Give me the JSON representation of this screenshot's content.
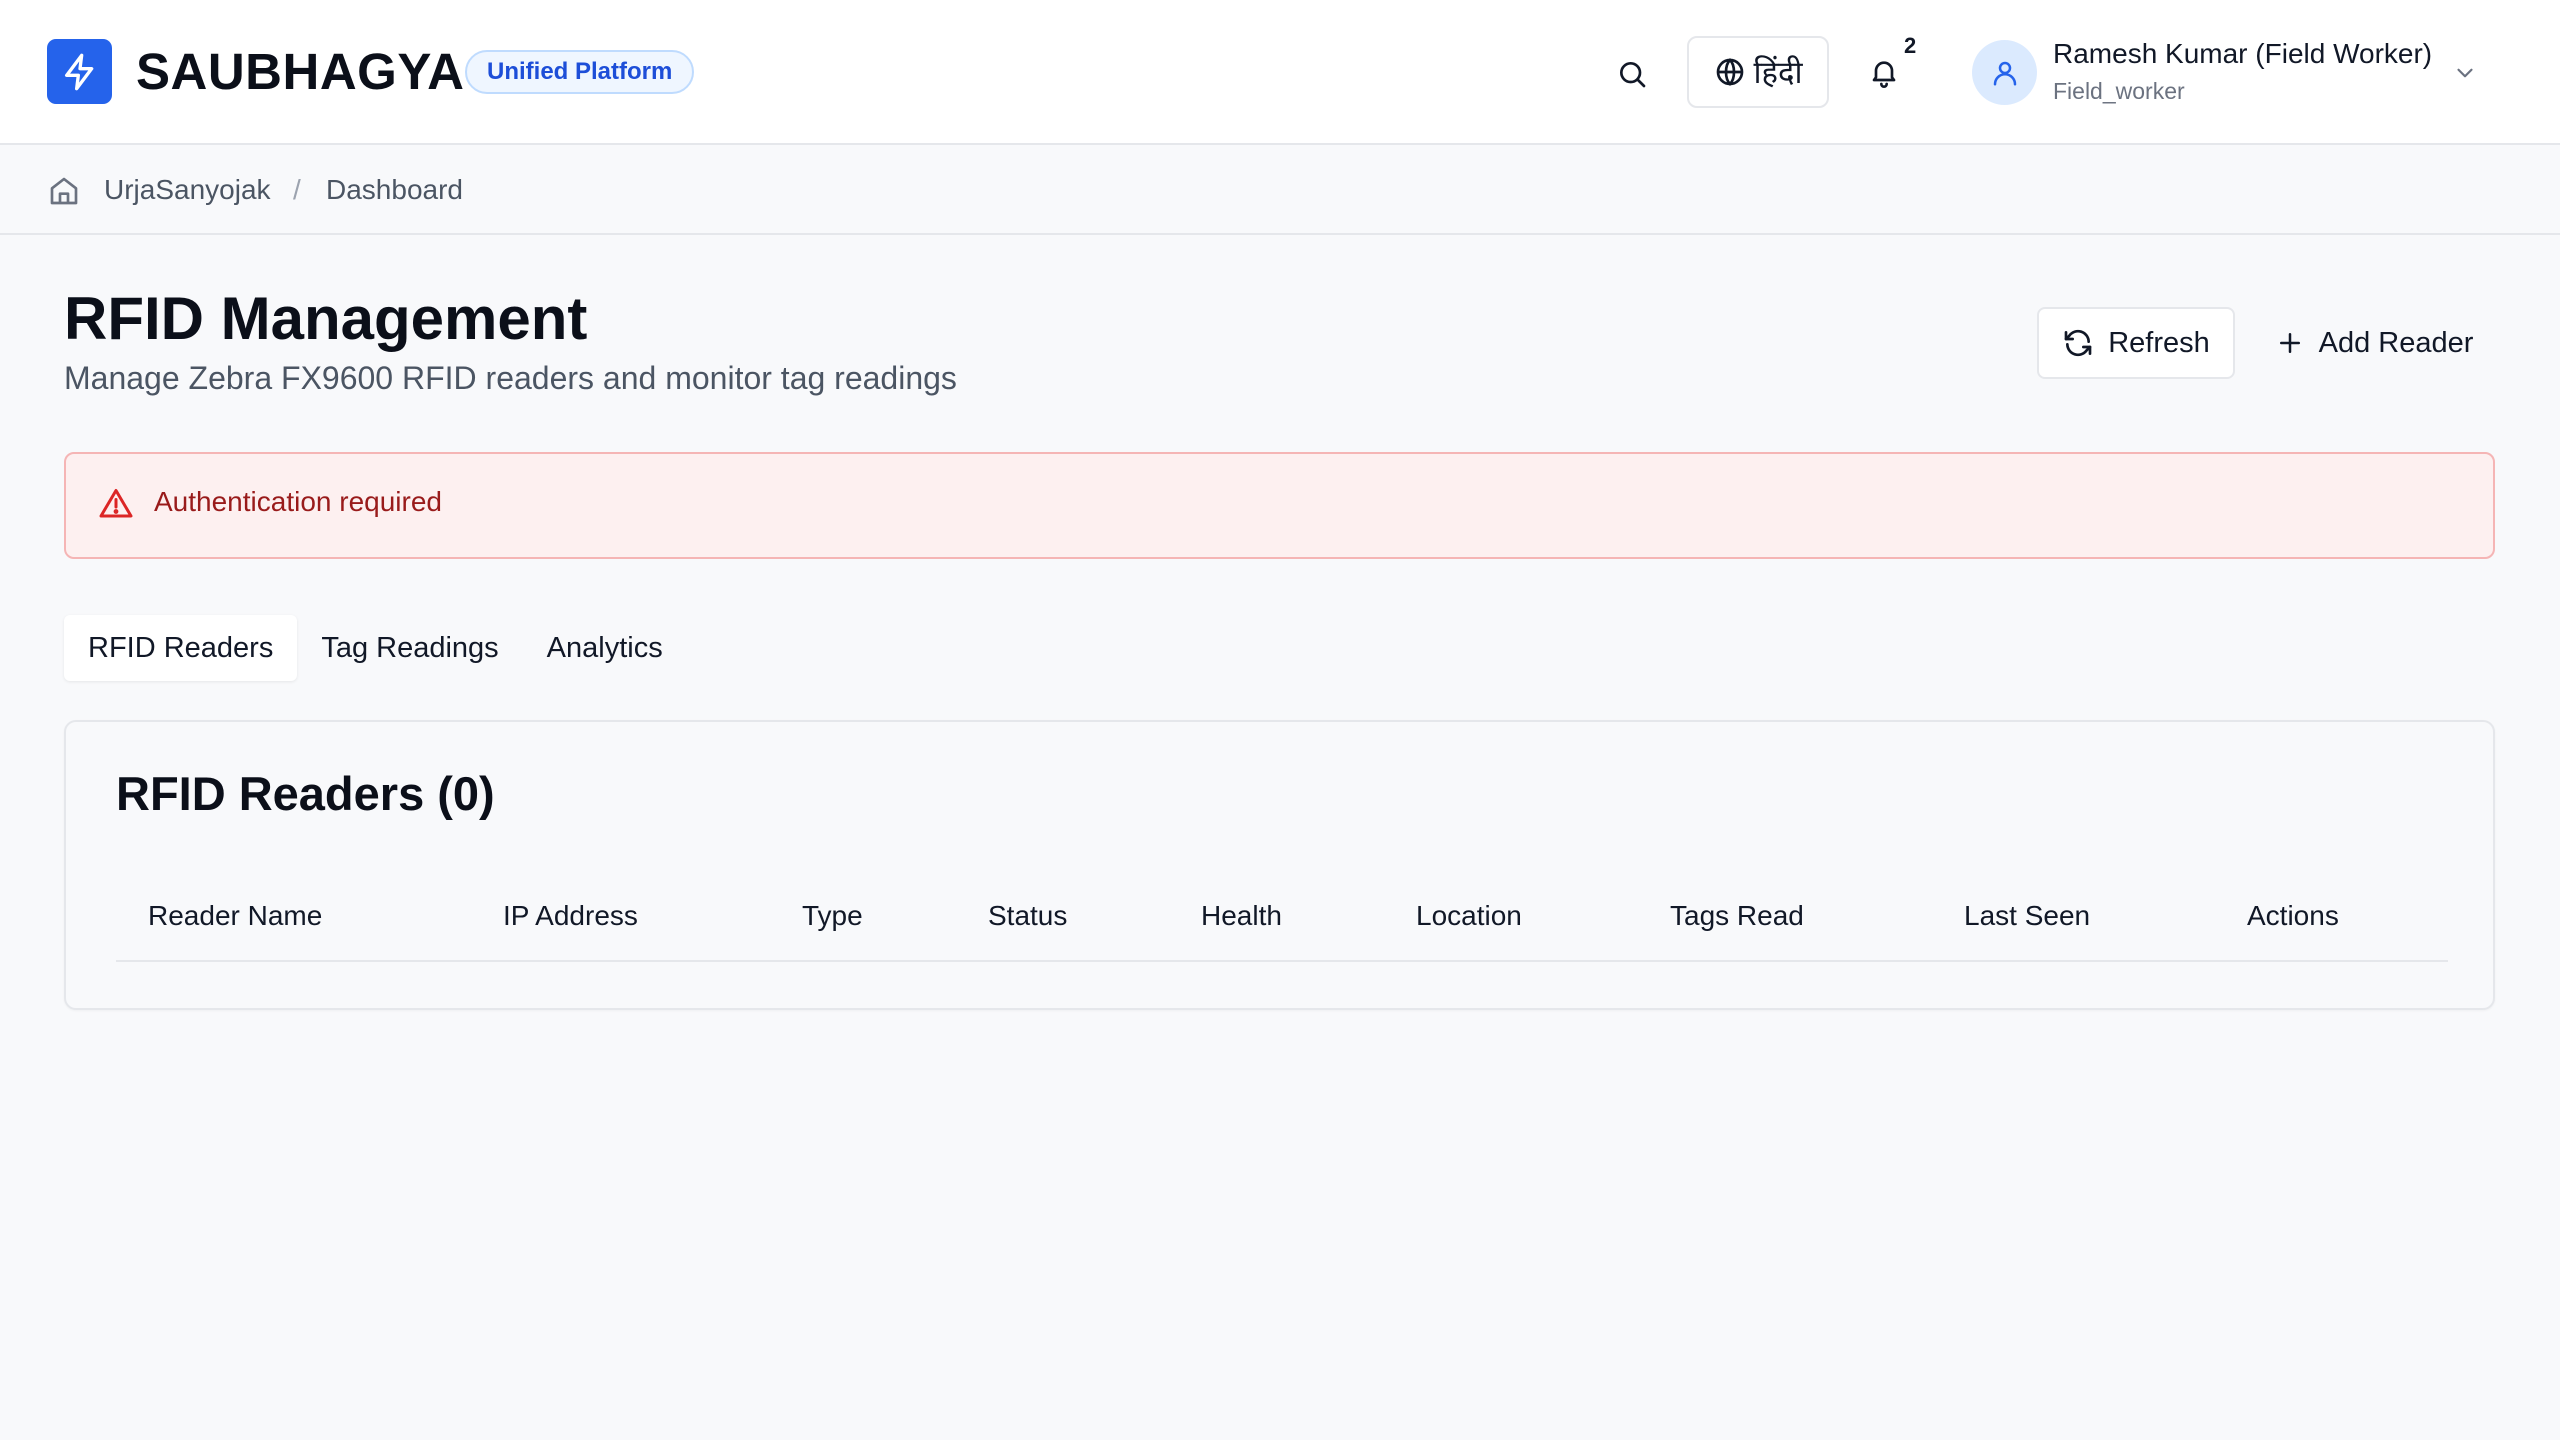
{
  "header": {
    "brand": "SAUBHAGYA",
    "badge": "Unified Platform",
    "language_label": "हिंदी",
    "notification_count": "2",
    "user": {
      "name": "Ramesh Kumar (Field Worker)",
      "role": "Field_worker"
    },
    "icons": [
      "bolt-icon",
      "search-icon",
      "globe-icon",
      "bell-icon",
      "user-icon",
      "chevron-down-icon"
    ]
  },
  "breadcrumb": {
    "items": [
      "UrjaSanyojak",
      "Dashboard"
    ],
    "separator": "/"
  },
  "page": {
    "title": "RFID Management",
    "subtitle": "Manage Zebra FX9600 RFID readers and monitor tag readings",
    "refresh_label": "Refresh",
    "add_label": "Add Reader"
  },
  "alert": {
    "message": "Authentication required"
  },
  "tabs": [
    {
      "label": "RFID Readers",
      "active": true
    },
    {
      "label": "Tag Readings",
      "active": false
    },
    {
      "label": "Analytics",
      "active": false
    }
  ],
  "readers_card": {
    "title": "RFID Readers (0)",
    "columns": [
      "Reader Name",
      "IP Address",
      "Type",
      "Status",
      "Health",
      "Location",
      "Tags Read",
      "Last Seen",
      "Actions"
    ],
    "rows": []
  },
  "colors": {
    "primary": "#2563eb",
    "alert_bg": "#fdf0f0",
    "alert_text": "#991b1b",
    "badge_text": "#1d4ed8"
  }
}
